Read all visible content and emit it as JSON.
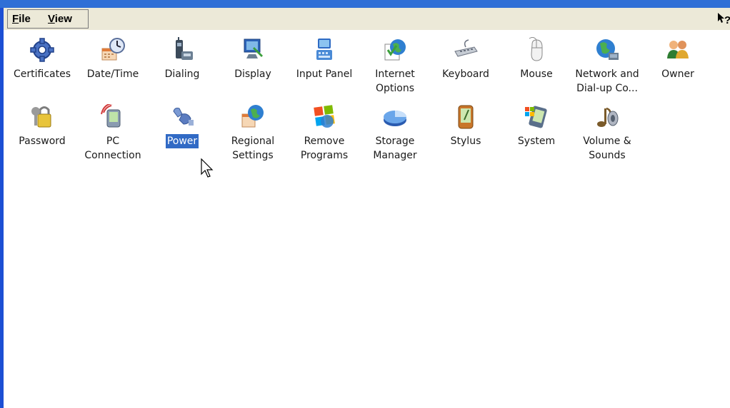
{
  "menubar": {
    "file_label": "File",
    "file_mnemonic": "F",
    "file_rest": "ile",
    "view_label": "View",
    "view_mnemonic": "V",
    "view_rest": "iew",
    "help_icon": "help-question-icon"
  },
  "items": [
    {
      "label": "Certificates",
      "icon": "certificates-gear-icon"
    },
    {
      "label": "Date/Time",
      "icon": "date-time-clock-icon"
    },
    {
      "label": "Dialing",
      "icon": "dialing-phone-icon"
    },
    {
      "label": "Display",
      "icon": "display-monitor-icon"
    },
    {
      "label": "Input Panel",
      "icon": "input-panel-icon"
    },
    {
      "label": "Internet\nOptions",
      "icon": "internet-options-globe-icon"
    },
    {
      "label": "Keyboard",
      "icon": "keyboard-icon"
    },
    {
      "label": "Mouse",
      "icon": "mouse-icon"
    },
    {
      "label": "Network and\nDial-up Co...",
      "icon": "network-globe-icon"
    },
    {
      "label": "Owner",
      "icon": "owner-users-icon"
    },
    {
      "label": "Password",
      "icon": "password-keys-icon"
    },
    {
      "label": "PC\nConnection",
      "icon": "pc-connection-icon"
    },
    {
      "label": "Power",
      "icon": "power-plug-icon",
      "selected": true
    },
    {
      "label": "Regional\nSettings",
      "icon": "regional-settings-globe-icon"
    },
    {
      "label": "Remove\nPrograms",
      "icon": "remove-programs-icon"
    },
    {
      "label": "Storage\nManager",
      "icon": "storage-manager-pie-icon"
    },
    {
      "label": "Stylus",
      "icon": "stylus-device-icon"
    },
    {
      "label": "System",
      "icon": "system-device-icon"
    },
    {
      "label": "Volume &\nSounds",
      "icon": "volume-sounds-icon"
    }
  ],
  "colors": {
    "title_bar": "#2f6fd6",
    "menubar_bg": "#ece9d8",
    "selection": "#316ac5"
  }
}
